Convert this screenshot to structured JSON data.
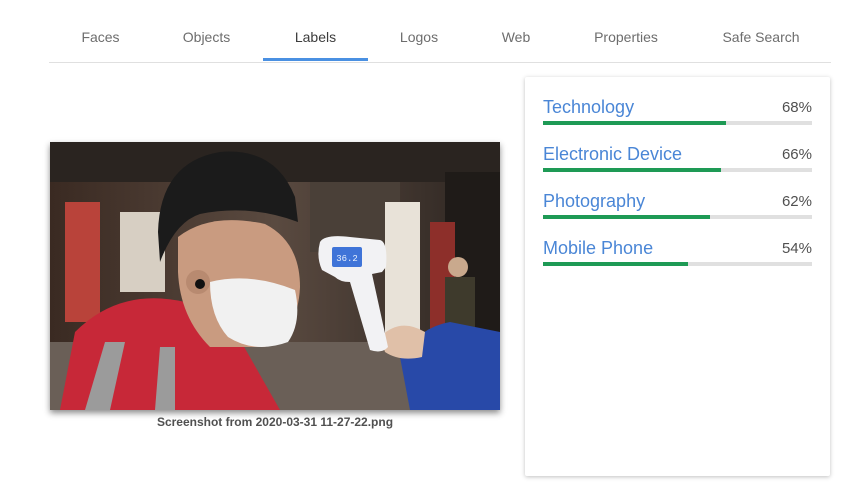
{
  "tabs": [
    {
      "label": "Faces"
    },
    {
      "label": "Objects"
    },
    {
      "label": "Labels",
      "active": true
    },
    {
      "label": "Logos"
    },
    {
      "label": "Web"
    },
    {
      "label": "Properties"
    },
    {
      "label": "Safe Search"
    }
  ],
  "image": {
    "caption": "Screenshot from 2020-03-31 11-27-22.png",
    "thermometer_display": "36.2"
  },
  "labels": [
    {
      "name": "Technology",
      "score_text": "68%",
      "score": 0.68
    },
    {
      "name": "Electronic Device",
      "score_text": "66%",
      "score": 0.66
    },
    {
      "name": "Photography",
      "score_text": "62%",
      "score": 0.62
    },
    {
      "name": "Mobile Phone",
      "score_text": "54%",
      "score": 0.54
    }
  ],
  "colors": {
    "accent": "#4a90e2",
    "label_text": "#4a86d6",
    "bar_fill": "#1e9a55",
    "bar_track": "#e0e0e0"
  }
}
